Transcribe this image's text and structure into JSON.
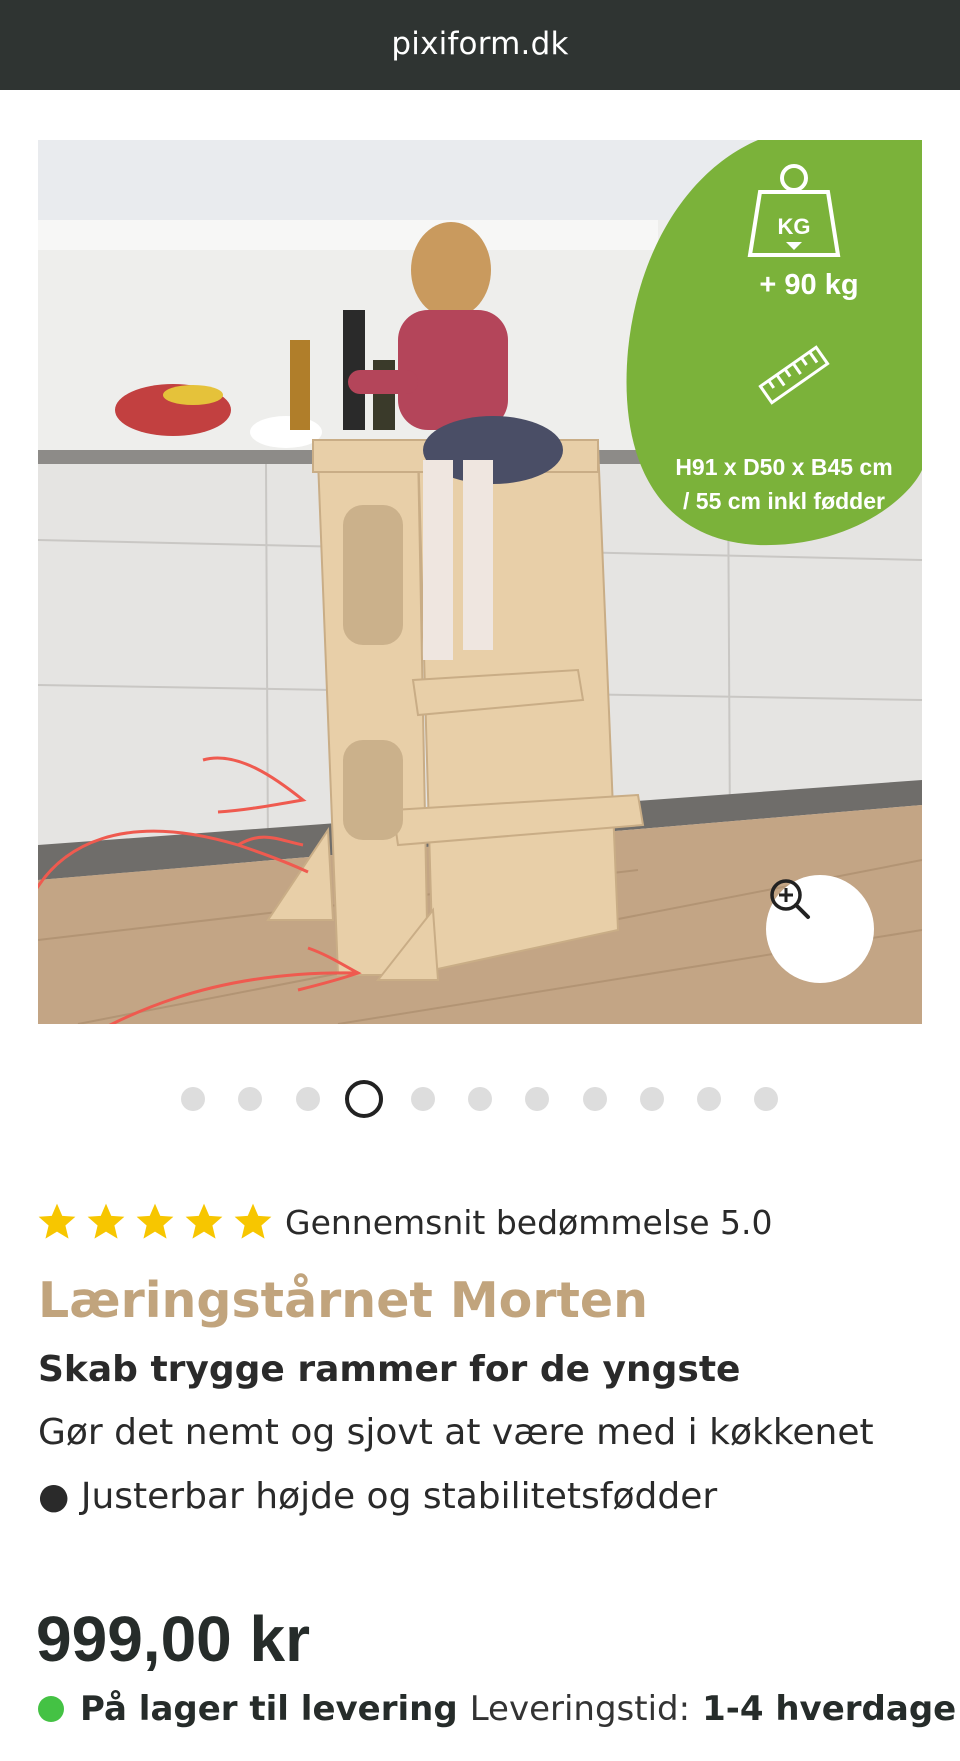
{
  "browser": {
    "domain": "pixiform.dk"
  },
  "image": {
    "badge_weight": "+ 90 kg",
    "badge_dimensions_line1": "H91 x D50 x B45 cm",
    "badge_dimensions_line2": "/ 55 cm inkl fødder",
    "badge_kg_label": "KG",
    "badge_color": "#7bb23a",
    "zoom_icon": "zoom-in-icon"
  },
  "carousel": {
    "total": 11,
    "active_index": 3
  },
  "rating": {
    "stars": 5,
    "text": "Gennemsnit bedømmelse 5.0",
    "star_color": "#f7c600"
  },
  "product": {
    "title": "Læringstårnet Morten",
    "subtitle": "Skab trygge rammer for de yngste",
    "description": "Gør det nemt og sjovt at være med i køkkenet",
    "feature": "● Justerbar højde og stabilitetsfødder",
    "price": "999,00 kr"
  },
  "stock": {
    "status": "På lager til levering",
    "delivery_label": "Leveringstid:",
    "delivery_time": "1-4 hverdage",
    "status_color": "#44c244"
  }
}
